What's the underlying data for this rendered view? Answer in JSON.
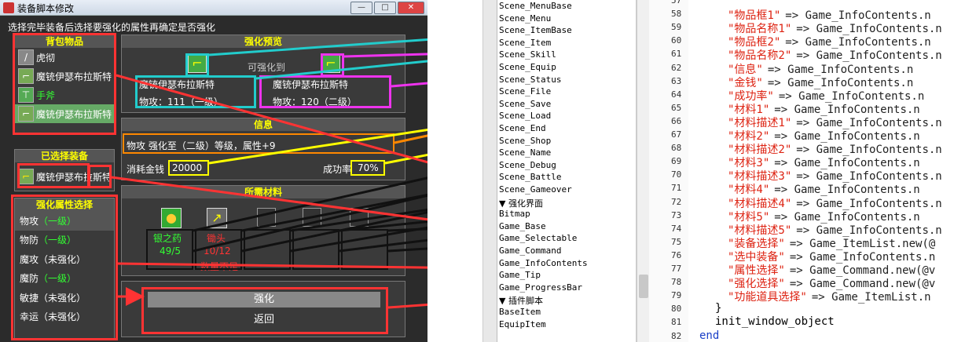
{
  "window": {
    "title": "装备脚本修改",
    "hint": "选择完毕装备后选择要强化的属性再确定是否强化"
  },
  "bag": {
    "header": "背包物品",
    "items": [
      {
        "name": "虎彻",
        "icon": "sword-icon",
        "color": "#ffffff"
      },
      {
        "name": "魔铳伊瑟布拉斯特",
        "icon": "gun-icon",
        "color": "#ffffff"
      },
      {
        "name": "手斧",
        "icon": "axe-icon",
        "color": "#33ff33"
      },
      {
        "name": "魔铳伊瑟布拉斯特",
        "icon": "gun-icon",
        "color": "#ffffff"
      }
    ]
  },
  "selected": {
    "header": "已选择装备",
    "item": "魔铳伊瑟布拉斯特"
  },
  "attrs": {
    "header": "强化属性选择",
    "items": [
      {
        "name": "物攻",
        "state": "（一级）"
      },
      {
        "name": "物防",
        "state": "（一级）"
      },
      {
        "name": "魔攻",
        "state": "（未强化）"
      },
      {
        "name": "魔防",
        "state": "（一级）"
      },
      {
        "name": "敏捷",
        "state": "（未强化）"
      },
      {
        "name": "幸运",
        "state": "（未强化）"
      }
    ]
  },
  "preview": {
    "header": "强化预览",
    "arrow_text": "可强化到",
    "left": {
      "name": "魔铳伊瑟布拉斯特",
      "stat": "物攻：111（一级）"
    },
    "right": {
      "name": "魔铳伊瑟布拉斯特",
      "stat": "物攻：120（二级）"
    }
  },
  "info": {
    "header": "信息",
    "text": "物攻 强化至（二级）等级，属性+9",
    "gold_label": "消耗金钱",
    "gold": "20000",
    "rate_label": "成功率",
    "rate": "70%"
  },
  "materials": {
    "header": "所需材料",
    "items": [
      {
        "name": "银之药",
        "count": "49/5",
        "note": ""
      },
      {
        "name": "锄头",
        "count": "10/12",
        "note": "数量不足"
      }
    ]
  },
  "commands": {
    "confirm": "强化",
    "back": "返回"
  },
  "list": {
    "items": [
      "Scene_MenuBase",
      "Scene_Menu",
      "Scene_ItemBase",
      "Scene_Item",
      "Scene_Skill",
      "Scene_Equip",
      "Scene_Status",
      "Scene_File",
      "Scene_Save",
      "Scene_Load",
      "Scene_End",
      "Scene_Shop",
      "Scene_Name",
      "Scene_Debug",
      "Scene_Battle",
      "Scene_Gameover",
      "▼ 强化界面",
      "Bitmap",
      "Game_Base",
      "Game_Selectable",
      "Game_Command",
      "Game_InfoContents",
      "Game_Tip",
      "Game_ProgressBar",
      "▼ 插件脚本",
      "BaseItem",
      "EquipItem"
    ]
  },
  "code": {
    "lines": [
      {
        "n": "57",
        "key": "",
        "val": ""
      },
      {
        "n": "58",
        "key": "\"物品框1\"",
        "val": "=> Game_InfoContents.n"
      },
      {
        "n": "59",
        "key": "\"物品名称1\"",
        "val": "=> Game_InfoContents.n"
      },
      {
        "n": "60",
        "key": "\"物品框2\"",
        "val": "=> Game_InfoContents.n"
      },
      {
        "n": "61",
        "key": "\"物品名称2\"",
        "val": "=> Game_InfoContents.n"
      },
      {
        "n": "62",
        "key": "\"信息\"",
        "val": "=> Game_InfoContents.n"
      },
      {
        "n": "63",
        "key": "\"金钱\"",
        "val": "=> Game_InfoContents.n"
      },
      {
        "n": "64",
        "key": "\"成功率\"",
        "val": "=> Game_InfoContents.n"
      },
      {
        "n": "65",
        "key": "\"材料1\"",
        "val": "=> Game_InfoContents.n"
      },
      {
        "n": "66",
        "key": "\"材料描述1\"",
        "val": "=> Game_InfoContents.n"
      },
      {
        "n": "67",
        "key": "\"材料2\"",
        "val": "=> Game_InfoContents.n"
      },
      {
        "n": "68",
        "key": "\"材料描述2\"",
        "val": "=> Game_InfoContents.n"
      },
      {
        "n": "69",
        "key": "\"材料3\"",
        "val": "=> Game_InfoContents.n"
      },
      {
        "n": "70",
        "key": "\"材料描述3\"",
        "val": "=> Game_InfoContents.n"
      },
      {
        "n": "71",
        "key": "\"材料4\"",
        "val": "=> Game_InfoContents.n"
      },
      {
        "n": "72",
        "key": "\"材料描述4\"",
        "val": "=> Game_InfoContents.n"
      },
      {
        "n": "73",
        "key": "\"材料5\"",
        "val": "=> Game_InfoContents.n"
      },
      {
        "n": "74",
        "key": "\"材料描述5\"",
        "val": "=> Game_InfoContents.n"
      },
      {
        "n": "75",
        "key": "\"装备选择\"",
        "val": "=> Game_ItemList.new(@"
      },
      {
        "n": "76",
        "key": "\"选中装备\"",
        "val": "=> Game_InfoContents.n"
      },
      {
        "n": "77",
        "key": "\"属性选择\"",
        "val": "=> Game_Command.new(@v"
      },
      {
        "n": "78",
        "key": "\"强化选择\"",
        "val": "=> Game_Command.new(@v"
      },
      {
        "n": "79",
        "key": "\"功能道具选择\"",
        "val": "=> Game_ItemList.n"
      },
      {
        "n": "80",
        "key": "}",
        "val": ""
      },
      {
        "n": "81",
        "key": "init_window_object",
        "val": ""
      },
      {
        "n": "82",
        "key": "end",
        "val": ""
      }
    ]
  },
  "colors": {
    "red": "#ff3333",
    "cyan": "#22cccc",
    "magenta": "#ee33ee",
    "yellow": "#ffff00",
    "orange": "#ff8800",
    "black": "#111111"
  }
}
